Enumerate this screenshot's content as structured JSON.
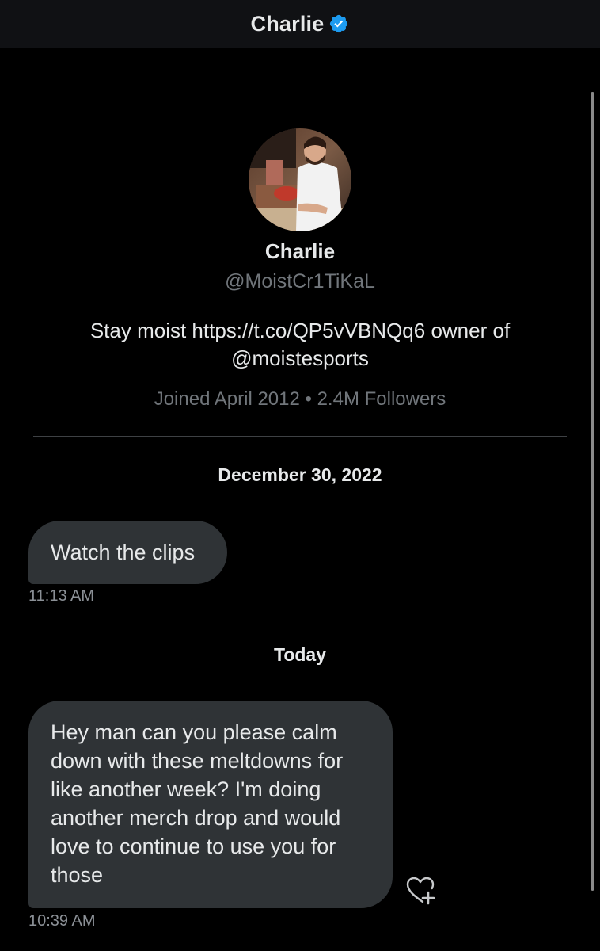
{
  "header": {
    "title": "Charlie",
    "verified_icon": "verified-check-icon"
  },
  "profile": {
    "name": "Charlie",
    "handle": "@MoistCr1TiKaL",
    "bio": "Stay moist https://t.co/QP5vVBNQq6 owner of @moistesports",
    "meta": "Joined April 2012 • 2.4M Followers"
  },
  "conversation": {
    "sections": [
      {
        "date": "December 30, 2022",
        "messages": [
          {
            "text": "Watch the clips",
            "time": "11:13 AM"
          }
        ]
      },
      {
        "date": "Today",
        "messages": [
          {
            "text": "Hey man can you please calm down with these meltdowns for like another week? I'm doing another merch drop and would love to continue to use you for those",
            "time": "10:39 AM"
          }
        ]
      }
    ]
  },
  "colors": {
    "background": "#000000",
    "header_bg": "#101114",
    "bubble_bg": "#2f3336",
    "text_primary": "#e7e9ea",
    "text_secondary": "#71767b",
    "verified_blue": "#1d9bf0"
  },
  "icons": {
    "reaction": "heart-plus-icon"
  }
}
